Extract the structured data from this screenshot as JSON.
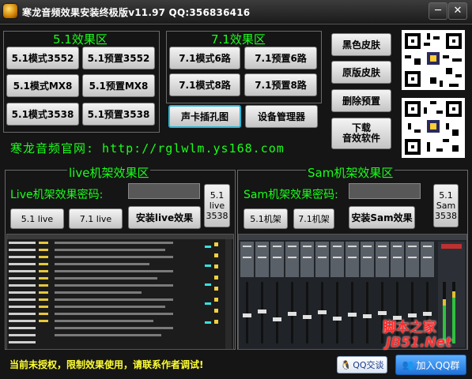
{
  "window": {
    "title": "寒龙音频效果安装终极版v11.97 QQ:356836416",
    "minimize": "─",
    "close": "✕"
  },
  "panel51": {
    "title": "5.1效果区",
    "buttons": [
      "5.1模式3552",
      "5.1预置3552",
      "5.1模式MX8",
      "5.1预置MX8",
      "5.1模式3538",
      "5.1预置3538"
    ]
  },
  "panel71": {
    "title": "7.1效果区",
    "buttons": [
      "7.1模式6路",
      "7.1预置6路",
      "7.1模式8路",
      "7.1预置8路"
    ]
  },
  "tools": {
    "soundcard_jack": "声卡插孔图",
    "device_manager": "设备管理器"
  },
  "side": {
    "black_skin": "黑色皮肤",
    "original_skin": "原版皮肤",
    "delete_preset": "删除预置",
    "download_line1": "下载",
    "download_line2": "音效软件"
  },
  "website": "寒龙音频官网: http://rglwlm.ys168.com",
  "live": {
    "title": "live机架效果区",
    "password_label": "Live机架效果密码:",
    "password_value": "",
    "btn_51": "5.1 live",
    "btn_71": "7.1 live",
    "install": "安装live效果",
    "side_line1": "5.1",
    "side_line2": "live",
    "side_line3": "3538"
  },
  "sam": {
    "title": "Sam机架效果区",
    "password_label": "Sam机架效果密码:",
    "password_value": "",
    "btn_51": "5.1机架",
    "btn_71": "7.1机架",
    "install": "安装Sam效果",
    "side_line1": "5.1",
    "side_line2": "Sam",
    "side_line3": "3538"
  },
  "status": "当前未授权，限制效果使用，请联系作者调试!",
  "qq_chat": "QQ交谈",
  "join_group": "加入QQ群",
  "watermark": {
    "line1": "脚本之家",
    "line2": "JB51.Net"
  },
  "colors": {
    "accent_green": "#1aff1a",
    "status_yellow": "#ffff33",
    "background": "#151515"
  }
}
